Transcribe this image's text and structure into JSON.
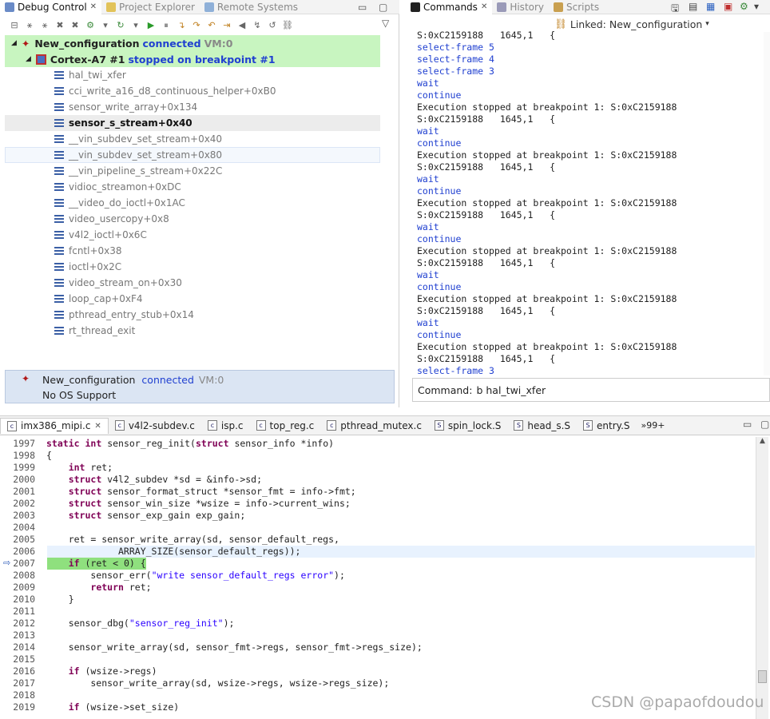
{
  "debug_panel": {
    "tabs": [
      {
        "label": "Debug Control",
        "close": "✕"
      },
      {
        "label": "Project Explorer"
      },
      {
        "label": "Remote Systems"
      }
    ],
    "session": {
      "name": "New_configuration",
      "status": "connected",
      "vm": "VM:0"
    },
    "core": {
      "name": "Cortex-A7 #1",
      "status": "stopped on breakpoint #1"
    },
    "frames": [
      "hal_twi_xfer",
      "cci_write_a16_d8_continuous_helper+0xB0",
      "sensor_write_array+0x134",
      "sensor_s_stream+0x40",
      "__vin_subdev_set_stream+0x40",
      "__vin_subdev_set_stream+0x80",
      "__vin_pipeline_s_stream+0x22C",
      "vidioc_streamon+0xDC",
      "__video_do_ioctl+0x1AC",
      "video_usercopy+0x8",
      "v4l2_ioctl+0x6C",
      "fcntl+0x38",
      "ioctl+0x2C",
      "video_stream_on+0x30",
      "loop_cap+0xF4",
      "pthread_entry_stub+0x14",
      "rt_thread_exit"
    ],
    "info_box": {
      "name": "New_configuration",
      "status": "connected",
      "vm": "VM:0",
      "os": "No OS Support"
    }
  },
  "commands_panel": {
    "tabs": [
      {
        "label": "Commands",
        "close": "✕"
      },
      {
        "label": "History"
      },
      {
        "label": "Scripts"
      }
    ],
    "linked": "Linked: New_configuration",
    "output": [
      {
        "t": "S:0xC2159188   1645,1   {",
        "k": "out"
      },
      {
        "t": "select-frame 5",
        "k": "cmd"
      },
      {
        "t": "select-frame 4",
        "k": "cmd"
      },
      {
        "t": "select-frame 3",
        "k": "cmd"
      },
      {
        "t": "wait",
        "k": "cmd"
      },
      {
        "t": "continue",
        "k": "cmd"
      },
      {
        "t": "Execution stopped at breakpoint 1: S:0xC2159188",
        "k": "out"
      },
      {
        "t": "S:0xC2159188   1645,1   {",
        "k": "out"
      },
      {
        "t": "wait",
        "k": "cmd"
      },
      {
        "t": "continue",
        "k": "cmd"
      },
      {
        "t": "Execution stopped at breakpoint 1: S:0xC2159188",
        "k": "out"
      },
      {
        "t": "S:0xC2159188   1645,1   {",
        "k": "out"
      },
      {
        "t": "wait",
        "k": "cmd"
      },
      {
        "t": "continue",
        "k": "cmd"
      },
      {
        "t": "Execution stopped at breakpoint 1: S:0xC2159188",
        "k": "out"
      },
      {
        "t": "S:0xC2159188   1645,1   {",
        "k": "out"
      },
      {
        "t": "wait",
        "k": "cmd"
      },
      {
        "t": "continue",
        "k": "cmd"
      },
      {
        "t": "Execution stopped at breakpoint 1: S:0xC2159188",
        "k": "out"
      },
      {
        "t": "S:0xC2159188   1645,1   {",
        "k": "out"
      },
      {
        "t": "wait",
        "k": "cmd"
      },
      {
        "t": "continue",
        "k": "cmd"
      },
      {
        "t": "Execution stopped at breakpoint 1: S:0xC2159188",
        "k": "out"
      },
      {
        "t": "S:0xC2159188   1645,1   {",
        "k": "out"
      },
      {
        "t": "wait",
        "k": "cmd"
      },
      {
        "t": "continue",
        "k": "cmd"
      },
      {
        "t": "Execution stopped at breakpoint 1: S:0xC2159188",
        "k": "out"
      },
      {
        "t": "S:0xC2159188   1645,1   {",
        "k": "out"
      },
      {
        "t": "select-frame 3",
        "k": "cmd"
      }
    ],
    "command_label": "Command:",
    "command_value": "b hal_twi_xfer"
  },
  "editor": {
    "tabs": [
      {
        "label": "imx386_mipi.c",
        "close": "✕",
        "ext": "c"
      },
      {
        "label": "v4l2-subdev.c",
        "ext": "c"
      },
      {
        "label": "isp.c",
        "ext": "c"
      },
      {
        "label": "top_reg.c",
        "ext": "c"
      },
      {
        "label": "pthread_mutex.c",
        "ext": "c"
      },
      {
        "label": "spin_lock.S",
        "ext": "S"
      },
      {
        "label": "head_s.S",
        "ext": "S"
      },
      {
        "label": "entry.S",
        "ext": "S"
      }
    ],
    "overflow": "»99+",
    "lines": [
      {
        "n": "1997",
        "c": "static int sensor_reg_init(struct sensor_info *info)"
      },
      {
        "n": "1998",
        "c": "{"
      },
      {
        "n": "1999",
        "c": "    int ret;"
      },
      {
        "n": "2000",
        "c": "    struct v4l2_subdev *sd = &info->sd;"
      },
      {
        "n": "2001",
        "c": "    struct sensor_format_struct *sensor_fmt = info->fmt;"
      },
      {
        "n": "2002",
        "c": "    struct sensor_win_size *wsize = info->current_wins;"
      },
      {
        "n": "2003",
        "c": "    struct sensor_exp_gain exp_gain;"
      },
      {
        "n": "2004",
        "c": ""
      },
      {
        "n": "2005",
        "c": "    ret = sensor_write_array(sd, sensor_default_regs,"
      },
      {
        "n": "2006",
        "c": "             ARRAY_SIZE(sensor_default_regs));"
      },
      {
        "n": "2007",
        "c": "    if (ret < 0) {"
      },
      {
        "n": "2008",
        "c": "        sensor_err(\"write sensor_default_regs error\");"
      },
      {
        "n": "2009",
        "c": "        return ret;"
      },
      {
        "n": "2010",
        "c": "    }"
      },
      {
        "n": "2011",
        "c": ""
      },
      {
        "n": "2012",
        "c": "    sensor_dbg(\"sensor_reg_init\");"
      },
      {
        "n": "2013",
        "c": ""
      },
      {
        "n": "2014",
        "c": "    sensor_write_array(sd, sensor_fmt->regs, sensor_fmt->regs_size);"
      },
      {
        "n": "2015",
        "c": ""
      },
      {
        "n": "2016",
        "c": "    if (wsize->regs)"
      },
      {
        "n": "2017",
        "c": "        sensor_write_array(sd, wsize->regs, wsize->regs_size);"
      },
      {
        "n": "2018",
        "c": ""
      },
      {
        "n": "2019",
        "c": "    if (wsize->set_size)"
      }
    ]
  },
  "watermark": "CSDN @papaofdoudou",
  "colors": {
    "green_highlight": "#c8f5c0",
    "blue_text": "#2040d0",
    "keyword": "#7f0055",
    "string": "#2a00ff"
  }
}
